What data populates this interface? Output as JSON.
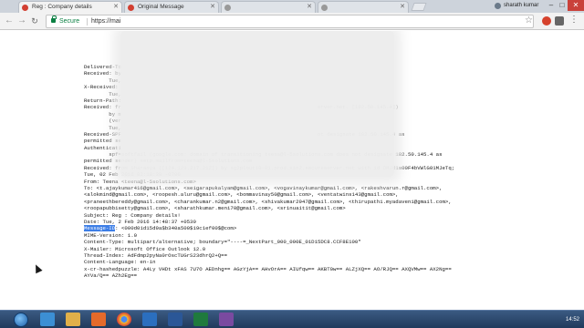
{
  "browser": {
    "tabs": [
      {
        "label": "Reg : Company details",
        "active": true
      },
      {
        "label": "Original Message",
        "active": false
      },
      {
        "label": "",
        "active": false
      },
      {
        "label": "",
        "active": false
      }
    ],
    "user": "sharath kumar",
    "omnibox": {
      "secure_label": "Secure",
      "url": "https://mai"
    }
  },
  "source": {
    "highlight_label": "Message-ID",
    "lines": [
      {
        "t": "Delivered-To"
      },
      {
        "t": "Received: by"
      },
      {
        "t": "        Tue,"
      },
      {
        "t": "X-Received: "
      },
      {
        "t": "        Tue,"
      },
      {
        "t": "Return-Path:"
      },
      {
        "t": "Received: fr                                                               erver.net. [182.50.145.4])"
      },
      {
        "t": "        by m"
      },
      {
        "t": "        (ver"
      },
      {
        "t": "        Tue,"
      },
      {
        "t": "Received-SPF                                                               ot designate 182.50.145.4 as"
      },
      {
        "t": "permitted se"
      },
      {
        "t": "Authenticati"
      },
      {
        "t": "        spf=softfail (google.com: domain of transitioning teena@l-5solutions.com does not designate 182.50.145.4 as"
      },
      {
        "t": "permitted sender) smtp.mailfrom=teena@l-5solutions.com"
      },
      {
        "t": "Received: from Sharanya ([124.123.217.212]) by sg2plout10-01.prod.sin2.secureserver.net with id DMJd1s00F4bVWlG01MJeTq;"
      },
      {
        "t": "Tue, 02 Feb 2016 02:18:39 -0700"
      },
      {
        "t": "From: Teena <teena@l-5solutions.com>"
      },
      {
        "t": "To: <t.ajaykumar416@gmail.com>, <seigarapukalyam@gmail.com>, <vogavinaykumar@gmail.com>, <rakeshvarun.r@gmail.com>,"
      },
      {
        "t": "<alokmind@gmail.com>, <roopesh.aluru@gmail.com>, <bommavinay50@gmail.com>, <ventatwins143@gmail.com>,"
      },
      {
        "t": "<praneethbereddy@gmail.com>, <charankumar.n2@gmail.com>, <shivakumar2947@gmail.com>, <thirupathi.myadaveni@gmail.com>,"
      },
      {
        "t": "<roopapubbisetty@gmail.com>, <sharathkumar.meni70@gmail.com>, <srinuaitit@gmail.com>"
      },
      {
        "t": "Subject: Reg : Company details!"
      },
      {
        "t": "Date: Tue, 2 Feb 2016 14:48:37 +0530"
      },
      {
        "t": ": <000d01d15d9a$b340a500$19c1ef00$@com>",
        "hl": true
      },
      {
        "t": "MIME-Version: 1.0"
      },
      {
        "t": "Content-Type: multipart/alternative; boundary=\"----=_NextPart_000_000E_01D15DC8.CCF8E100\""
      },
      {
        "t": "X-Mailer: Microsoft Office Outlook 12.0"
      },
      {
        "t": "Thread-Index: AdFdmp2pyNa0rOscTUGrS23dhrQ2+Q=="
      },
      {
        "t": "Content-Language: en-in"
      },
      {
        "t": "x-cr-hashedpuzzle: A4Ly VHDt xFAS 7U7O AEDnhg== AGzYjA== AHvOrA== AIUfqw== AKBT0w== ALZjXQ== AO/RJQ== AXQVMw== AX2Ng=="
      },
      {
        "t": "AYVa/Q== AZh2Eg=="
      }
    ]
  },
  "taskbar": {
    "time": "14:52"
  }
}
